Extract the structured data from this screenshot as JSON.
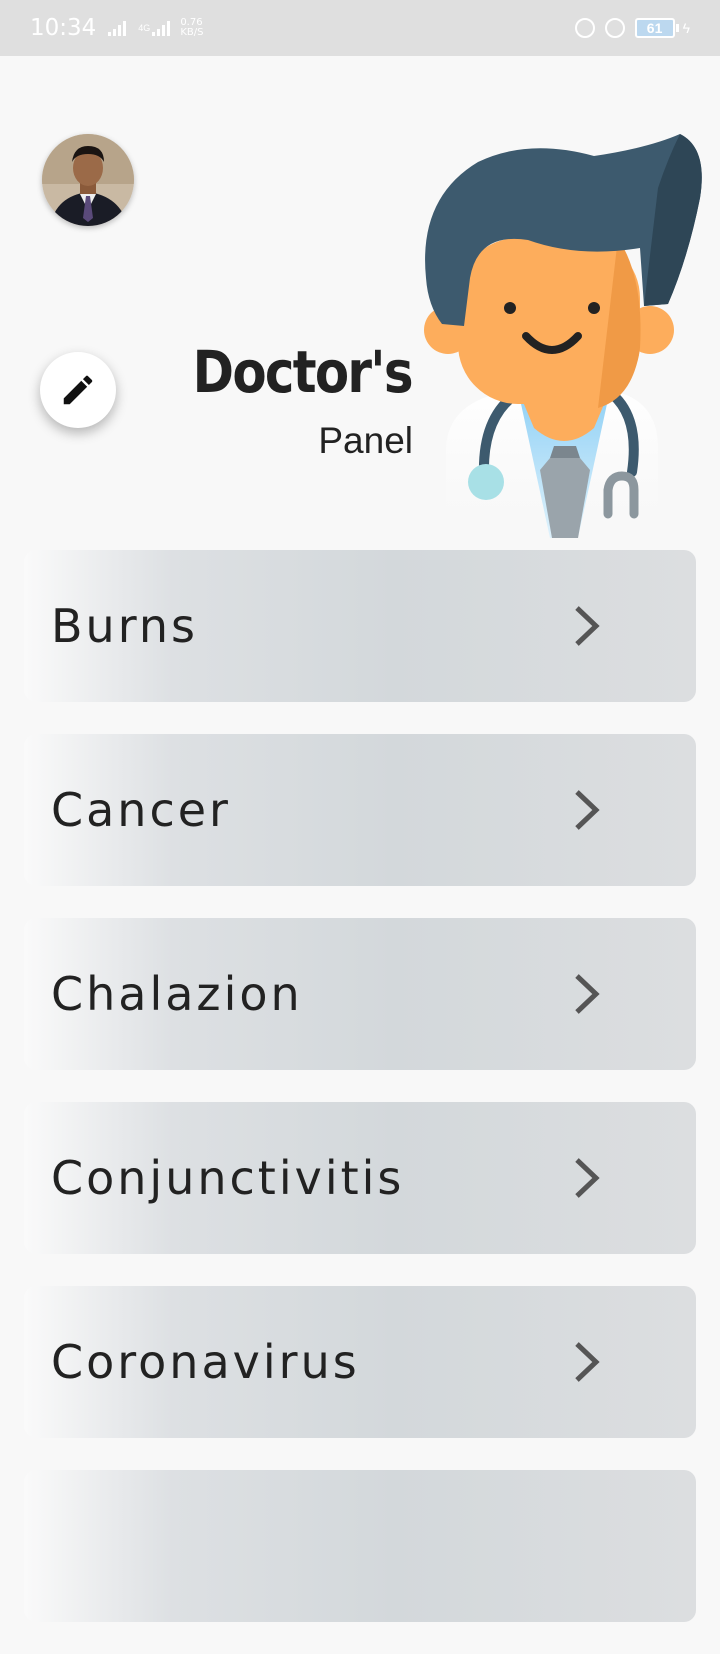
{
  "status_bar": {
    "time": "10:34",
    "network_type": "4G",
    "data_speed": "0.76",
    "data_speed_unit": "KB/S",
    "battery_level": "61"
  },
  "header": {
    "title": "Doctor's",
    "subtitle": "Panel"
  },
  "icons": {
    "edit": "pencil-icon",
    "chevron": "chevron-right-icon"
  },
  "diseases": [
    {
      "label": "Burns"
    },
    {
      "label": "Cancer"
    },
    {
      "label": "Chalazion"
    },
    {
      "label": "Conjunctivitis"
    },
    {
      "label": "Coronavirus"
    },
    {
      "label": ""
    }
  ],
  "colors": {
    "background": "#f8f8f8",
    "status_bar": "#dfdfdf",
    "card": "#d3d8db",
    "text": "#222222",
    "doctor_hair": "#3d5a6e",
    "doctor_skin": "#fdad5c"
  }
}
